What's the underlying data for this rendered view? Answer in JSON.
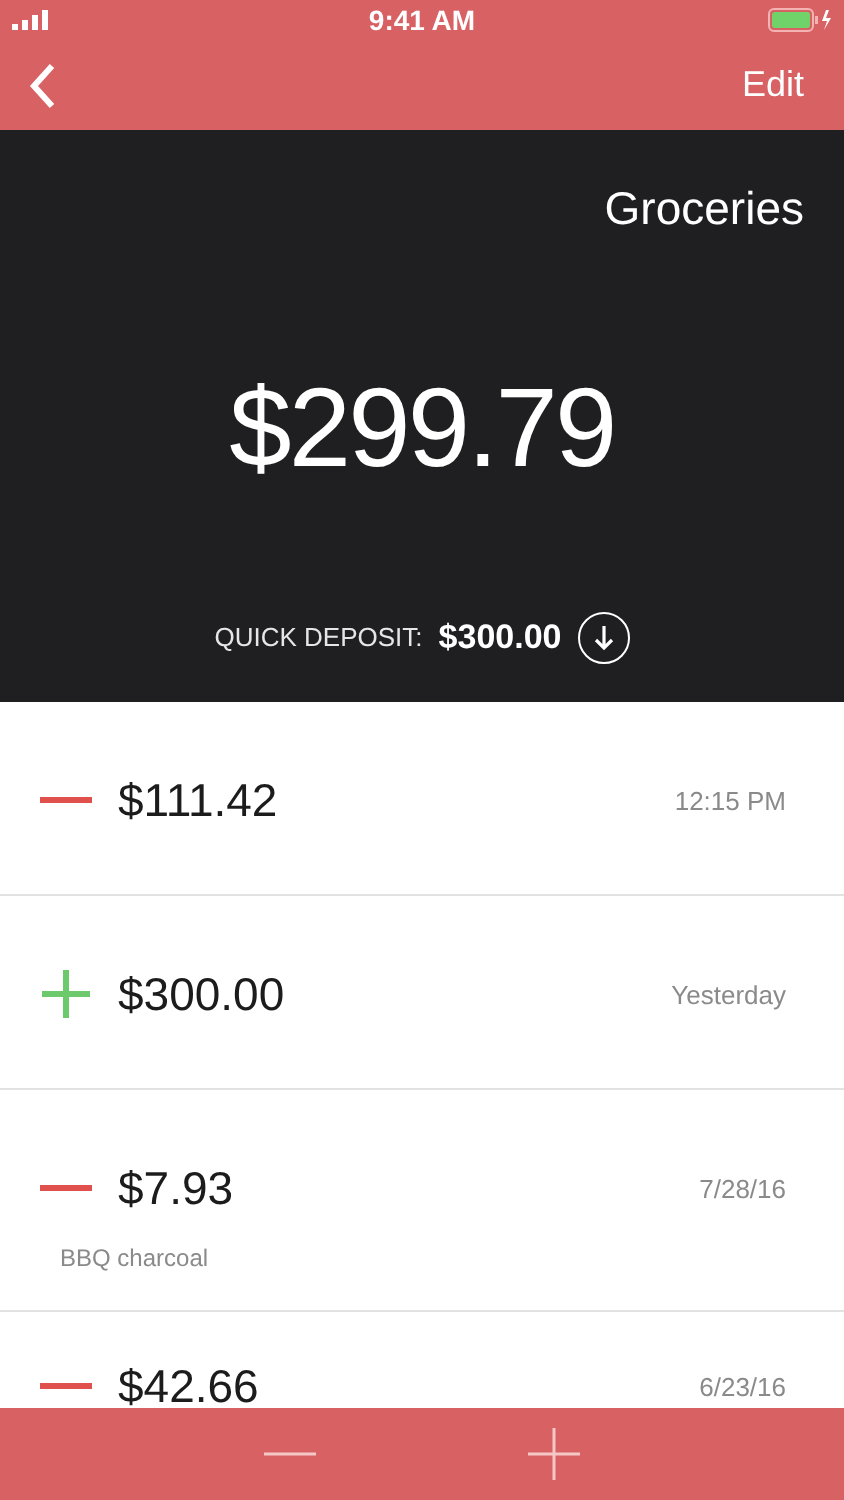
{
  "status_bar": {
    "time": "9:41 AM"
  },
  "nav": {
    "edit": "Edit"
  },
  "header": {
    "title": "Groceries",
    "balance": "$299.79",
    "quick_deposit_label": "QUICK DEPOSIT:",
    "quick_deposit_amount": "$300.00"
  },
  "transactions": [
    {
      "kind": "withdrawal",
      "amount": "$111.42",
      "date": "12:15 PM"
    },
    {
      "kind": "deposit",
      "amount": "$300.00",
      "date": "Yesterday"
    },
    {
      "kind": "withdrawal",
      "amount": "$7.93",
      "date": "7/28/16",
      "note": "BBQ charcoal"
    },
    {
      "kind": "withdrawal",
      "amount": "$42.66",
      "date": "6/23/16"
    }
  ]
}
